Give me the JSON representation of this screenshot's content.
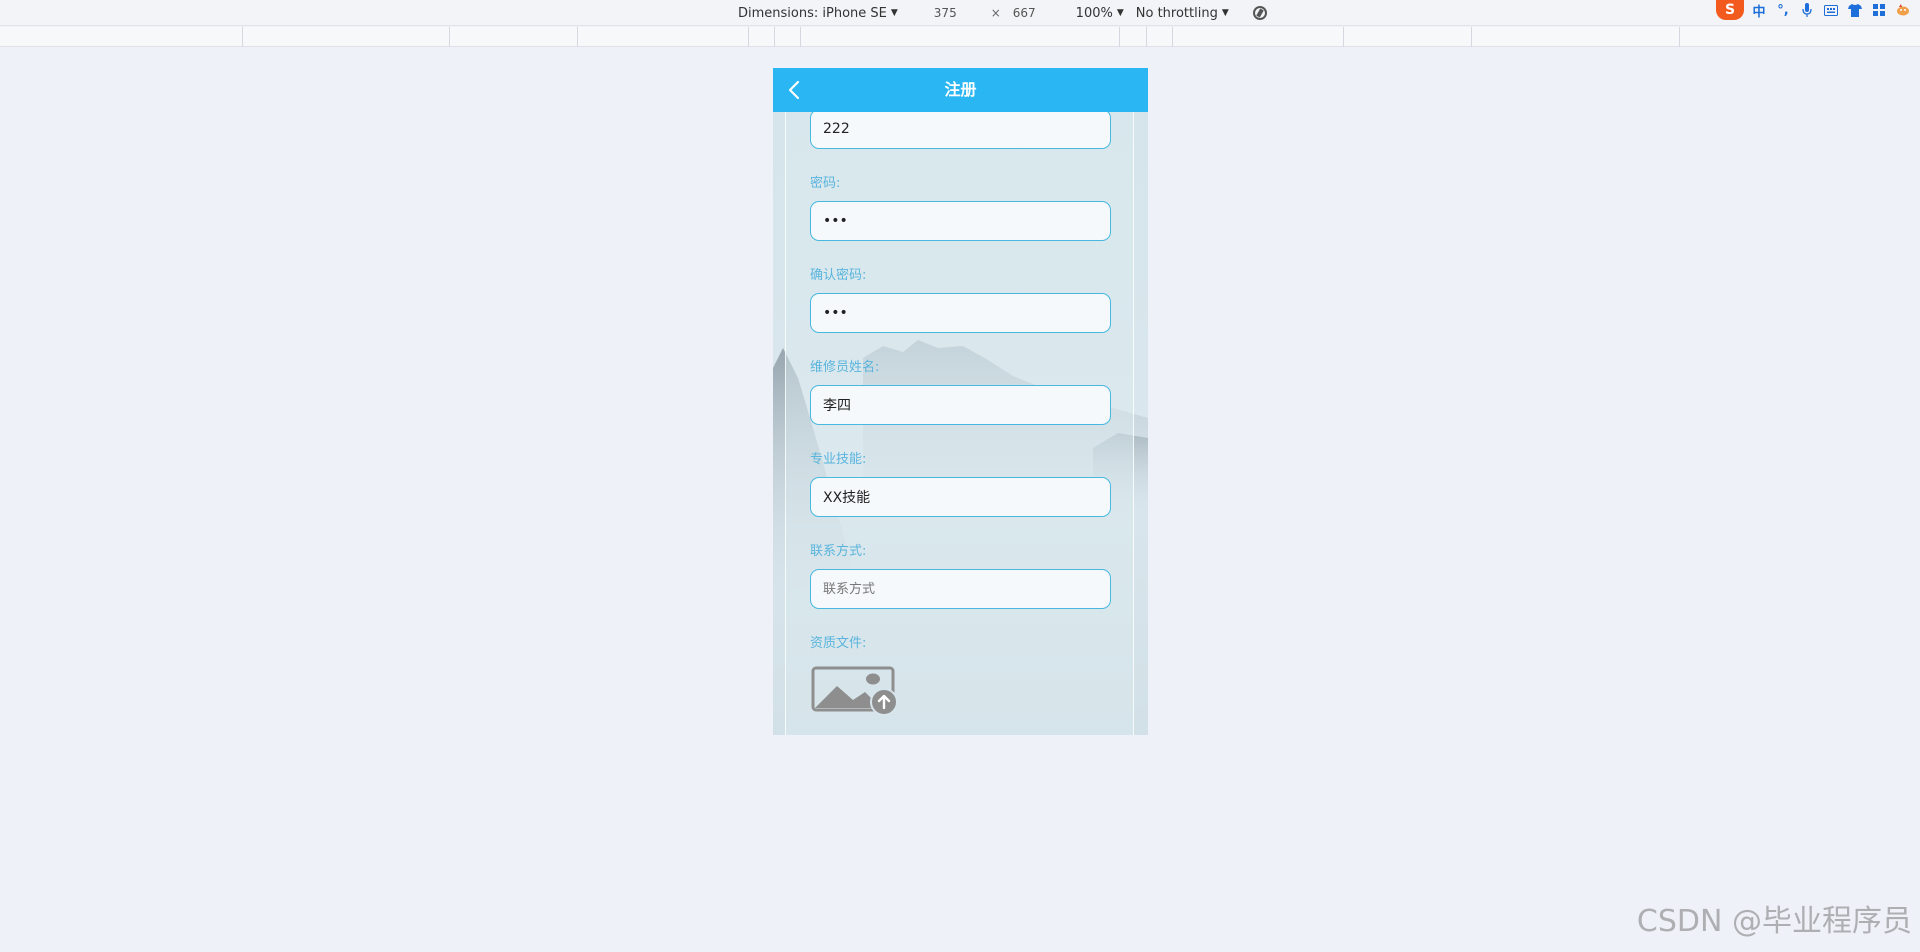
{
  "devtools": {
    "dimensions_label": "Dimensions: iPhone SE",
    "width_value": "375",
    "times": "×",
    "height_value": "667",
    "zoom": "100%",
    "throttling": "No throttling"
  },
  "ime": {
    "logo": "S",
    "lang": "中",
    "punct": "°,"
  },
  "header": {
    "title": "注册"
  },
  "form": {
    "username_value": "222",
    "password_label": "密码:",
    "password_value": "222",
    "confirm_label": "确认密码:",
    "confirm_value": "222",
    "name_label": "维修员姓名:",
    "name_value": "李四",
    "skill_label": "专业技能:",
    "skill_value": "XX技能",
    "contact_label": "联系方式:",
    "contact_placeholder": "联系方式",
    "file_label": "资质文件:"
  },
  "watermark": "CSDN @毕业程序员"
}
